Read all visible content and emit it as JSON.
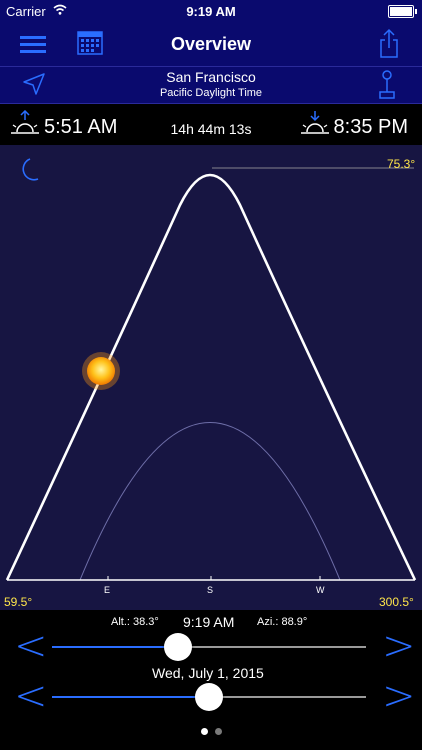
{
  "statusbar": {
    "carrier": "Carrier",
    "time": "9:19 AM"
  },
  "navbar": {
    "title": "Overview"
  },
  "location": {
    "city": "San Francisco",
    "timezone": "Pacific Daylight Time"
  },
  "sun": {
    "sunrise": "5:51 AM",
    "daylength": "14h 44m 13s",
    "sunset": "8:35 PM"
  },
  "plot": {
    "max_elevation": "75.3°",
    "rise_azimuth": "59.5°",
    "set_azimuth": "300.5°",
    "compass": {
      "east": "E",
      "south": "S",
      "west": "W"
    }
  },
  "controls": {
    "altitude": "Alt.: 38.3°",
    "time": "9:19 AM",
    "azimuth": "Azi.: 88.9°",
    "date": "Wed, July 1, 2015",
    "time_slider_fraction": 0.39,
    "date_slider_fraction": 0.5,
    "prev_symbol": "<",
    "next_symbol": ">"
  },
  "pager": {
    "pages": 2,
    "current": 1
  },
  "colors": {
    "accent": "#2a6dff",
    "bar": "#0a0a6e",
    "plot_bg": "#171542",
    "label_yellow": "#ffe64a"
  }
}
